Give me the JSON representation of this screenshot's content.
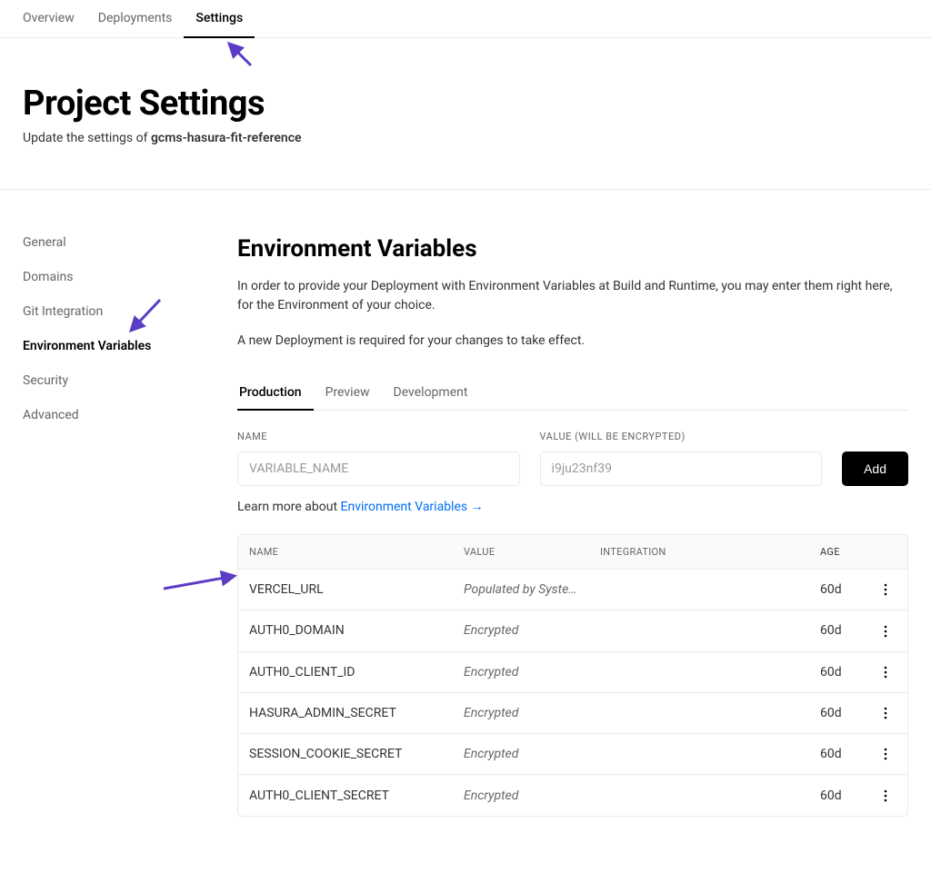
{
  "topTabs": [
    {
      "label": "Overview",
      "active": false
    },
    {
      "label": "Deployments",
      "active": false
    },
    {
      "label": "Settings",
      "active": true
    }
  ],
  "header": {
    "title": "Project Settings",
    "subtitlePrefix": "Update the settings of ",
    "projectName": "gcms-hasura-fit-reference"
  },
  "sidebar": {
    "items": [
      {
        "label": "General",
        "active": false
      },
      {
        "label": "Domains",
        "active": false
      },
      {
        "label": "Git Integration",
        "active": false
      },
      {
        "label": "Environment Variables",
        "active": true
      },
      {
        "label": "Security",
        "active": false
      },
      {
        "label": "Advanced",
        "active": false
      }
    ]
  },
  "main": {
    "sectionTitle": "Environment Variables",
    "desc1": "In order to provide your Deployment with Environment Variables at Build and Runtime, you may enter them right here, for the Environment of your choice.",
    "desc2": "A new Deployment is required for your changes to take effect.",
    "envTabs": [
      {
        "label": "Production",
        "active": true
      },
      {
        "label": "Preview",
        "active": false
      },
      {
        "label": "Development",
        "active": false
      }
    ],
    "form": {
      "nameLabel": "NAME",
      "valueLabel": "VALUE (WILL BE ENCRYPTED)",
      "namePlaceholder": "VARIABLE_NAME",
      "valuePlaceholder": "i9ju23nf39",
      "addLabel": "Add"
    },
    "learnMore": {
      "prefix": "Learn more about ",
      "linkText": "Environment Variables",
      "arrow": "→"
    },
    "table": {
      "headers": {
        "name": "NAME",
        "value": "VALUE",
        "integration": "INTEGRATION",
        "age": "AGE"
      },
      "rows": [
        {
          "name": "VERCEL_URL",
          "value": "Populated by Syste…",
          "integration": "",
          "age": "60d"
        },
        {
          "name": "AUTH0_DOMAIN",
          "value": "Encrypted",
          "integration": "",
          "age": "60d"
        },
        {
          "name": "AUTH0_CLIENT_ID",
          "value": "Encrypted",
          "integration": "",
          "age": "60d"
        },
        {
          "name": "HASURA_ADMIN_SECRET",
          "value": "Encrypted",
          "integration": "",
          "age": "60d"
        },
        {
          "name": "SESSION_COOKIE_SECRET",
          "value": "Encrypted",
          "integration": "",
          "age": "60d"
        },
        {
          "name": "AUTH0_CLIENT_SECRET",
          "value": "Encrypted",
          "integration": "",
          "age": "60d"
        }
      ]
    }
  }
}
